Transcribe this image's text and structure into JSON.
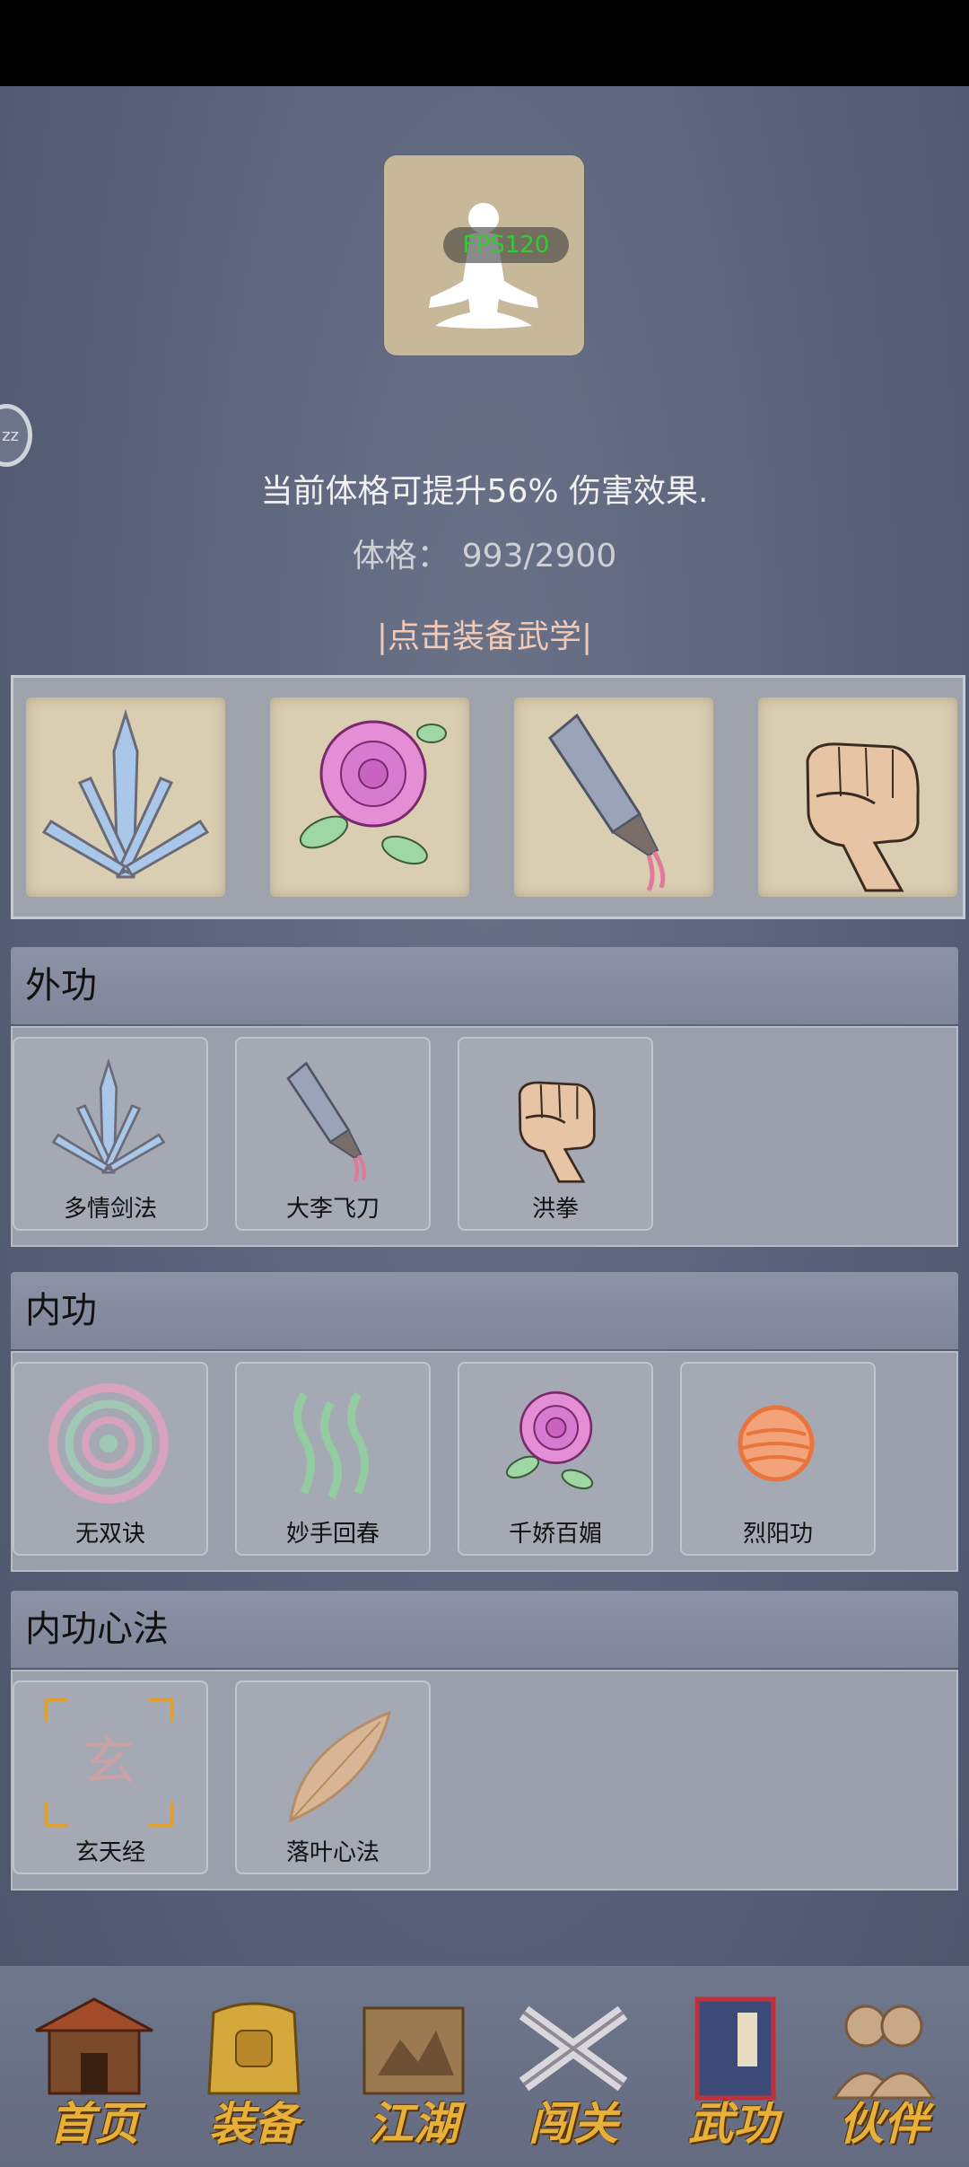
{
  "status": {
    "fps_label": "FPS120"
  },
  "side_button": {
    "label": "zz"
  },
  "stats": {
    "bonus_text": "当前体格可提升56% 伤害效果.",
    "physique_label": "体格：",
    "physique_value": "993/2900"
  },
  "equip_link": "|点击装备武学|",
  "equipped_slots": [
    {
      "icon": "crystal-blades-icon"
    },
    {
      "icon": "rose-icon"
    },
    {
      "icon": "flying-knife-icon"
    },
    {
      "icon": "fist-icon"
    }
  ],
  "sections": {
    "outer": {
      "title": "外功",
      "items": [
        {
          "label": "多情剑法",
          "icon": "crystal-blades-icon"
        },
        {
          "label": "大李飞刀",
          "icon": "flying-knife-icon"
        },
        {
          "label": "洪拳",
          "icon": "fist-icon"
        }
      ]
    },
    "inner": {
      "title": "内功",
      "items": [
        {
          "label": "无双诀",
          "icon": "swirl-icon"
        },
        {
          "label": "妙手回春",
          "icon": "green-waves-icon"
        },
        {
          "label": "千娇百媚",
          "icon": "rose-icon"
        },
        {
          "label": "烈阳功",
          "icon": "sun-orb-icon"
        }
      ]
    },
    "mind": {
      "title": "内功心法",
      "items": [
        {
          "label": "玄天经",
          "icon": "xuan-seal-icon",
          "glyph": "玄"
        },
        {
          "label": "落叶心法",
          "icon": "leaf-icon"
        }
      ]
    }
  },
  "nav": [
    {
      "label": "首页",
      "icon": "temple-icon"
    },
    {
      "label": "装备",
      "icon": "armor-icon"
    },
    {
      "label": "江湖",
      "icon": "scroll-map-icon"
    },
    {
      "label": "闯关",
      "icon": "crossed-swords-icon"
    },
    {
      "label": "武功",
      "icon": "book-icon"
    },
    {
      "label": "伙伴",
      "icon": "partners-icon"
    }
  ],
  "colors": {
    "accent_link": "#f2c9b5",
    "fps_green": "#35c935",
    "nav_gold": "#e5b13a"
  }
}
